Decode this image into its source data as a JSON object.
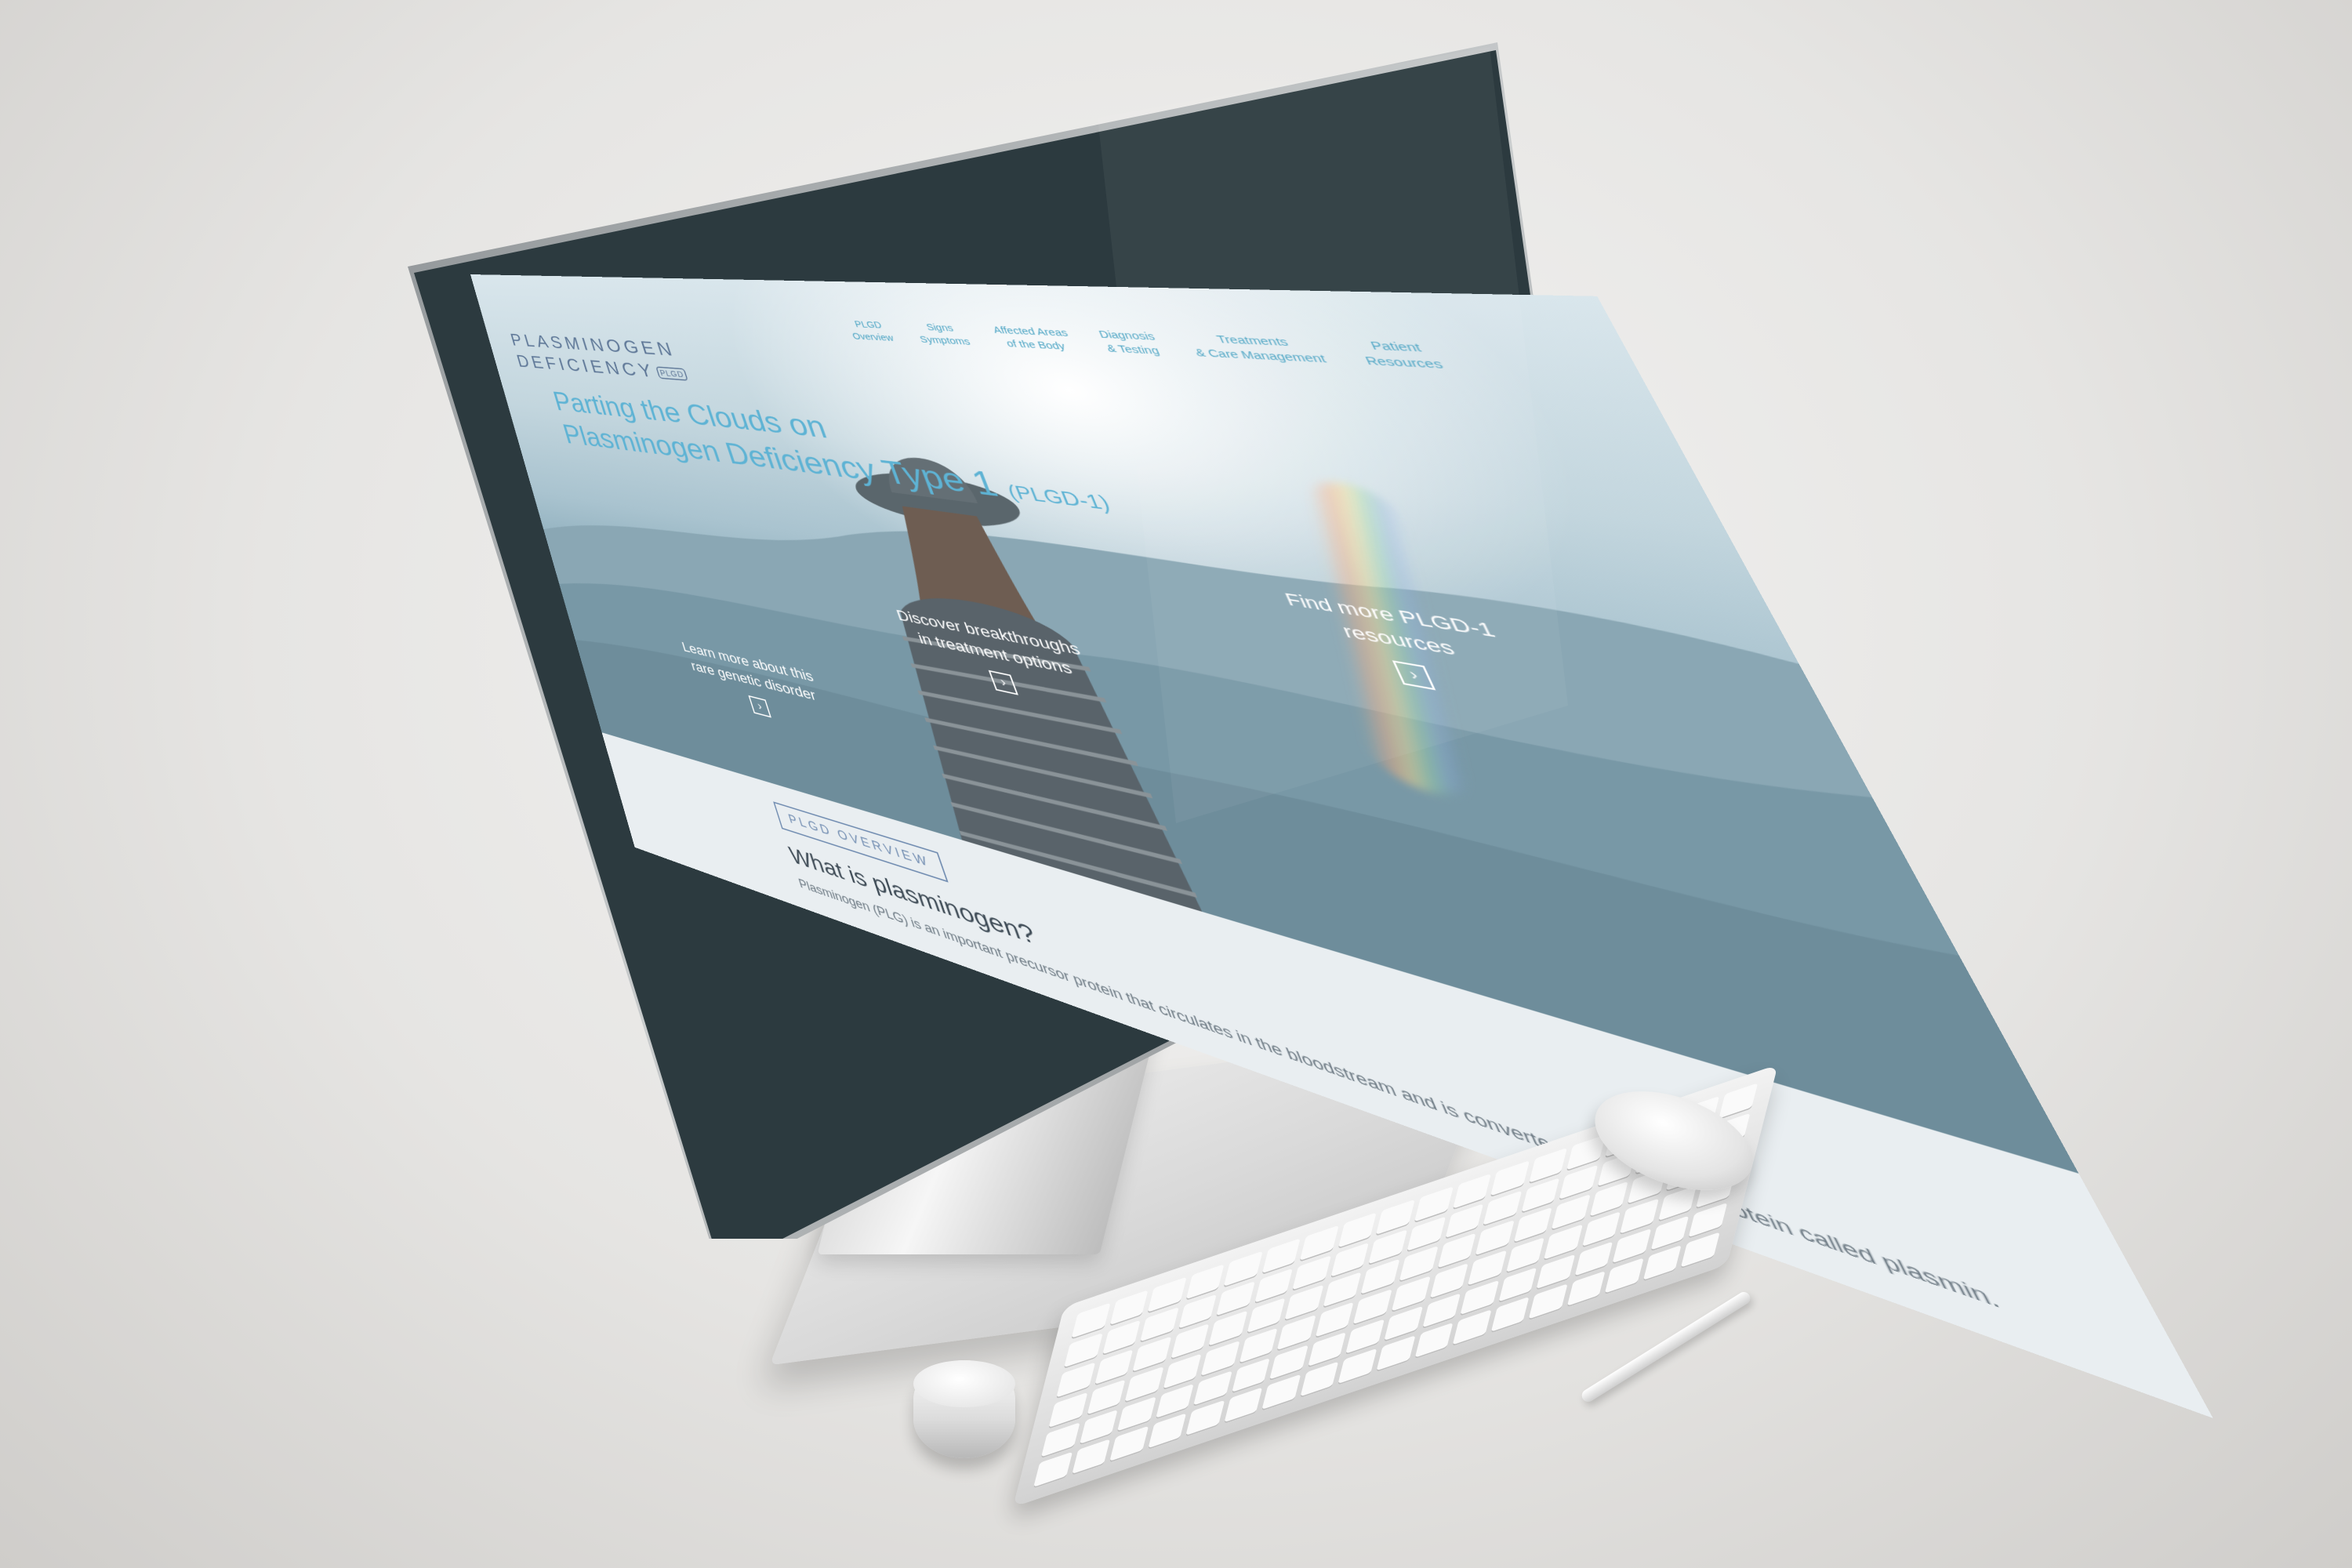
{
  "site": {
    "logo": {
      "line1": "PLASMINOGEN",
      "line2": "DEFICIENCY",
      "badge": "PLGD"
    },
    "nav": [
      {
        "line1": "PLGD",
        "line2": "Overview"
      },
      {
        "line1": "Signs",
        "line2": "Symptoms"
      },
      {
        "line1": "Affected Areas",
        "line2": "of the Body"
      },
      {
        "line1": "Diagnosis",
        "line2": "& Testing"
      },
      {
        "line1": "Treatments",
        "line2": "& Care Management"
      },
      {
        "line1": "Patient",
        "line2": "Resources"
      }
    ],
    "hero": {
      "headline_line1": "Parting the Clouds on",
      "headline_line2": "Plasminogen Deficiency Type 1",
      "headline_suffix": "(PLGD-1)"
    },
    "ctas": [
      {
        "line1": "Learn more about this",
        "line2": "rare genetic disorder",
        "button": "›"
      },
      {
        "line1": "Discover breakthroughs",
        "line2": "in treatment options",
        "button": "›"
      },
      {
        "line1": "Find more PLGD-1",
        "line2": "resources",
        "button": "›"
      }
    ],
    "section": {
      "tag": "PLGD OVERVIEW",
      "title": "What is plasminogen?",
      "body": "Plasminogen (PLG) is an important precursor protein that circulates in the bloodstream and is converted into another protein called plasmin."
    }
  },
  "colors": {
    "accent": "#5eb3d4",
    "logo": "#5e7797",
    "bezel": "#2c3a3f"
  }
}
